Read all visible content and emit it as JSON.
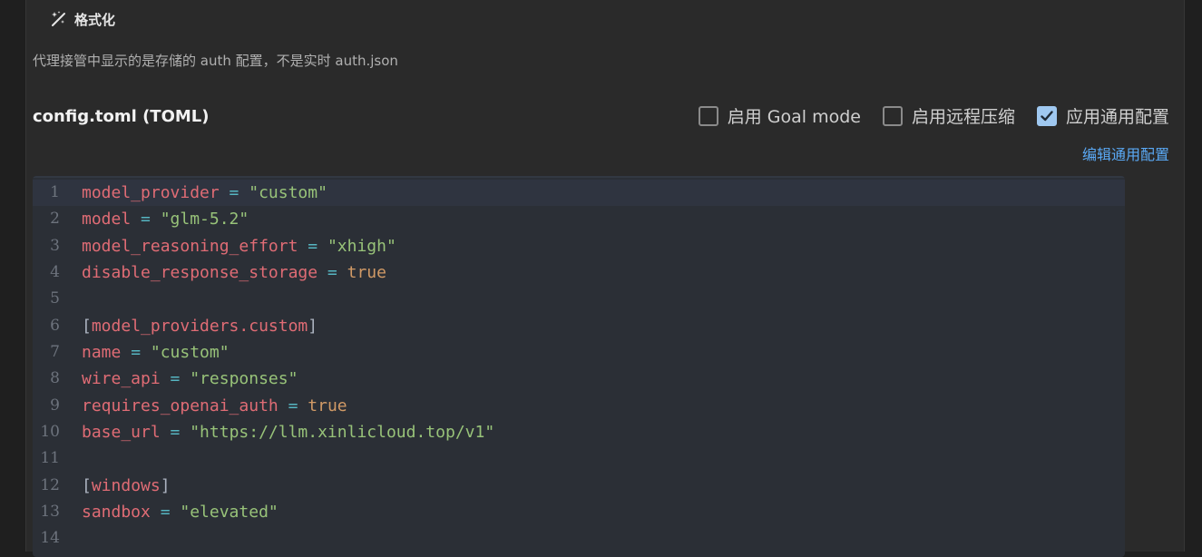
{
  "format": {
    "icon": "magic-wand-icon",
    "label": "格式化"
  },
  "hint": "代理接管中显示的是存储的 auth 配置，不是实时 auth.json",
  "config_title": "config.toml (TOML)",
  "options": [
    {
      "label": "启用 Goal mode",
      "checked": false
    },
    {
      "label": "启用远程压缩",
      "checked": false
    },
    {
      "label": "应用通用配置",
      "checked": true
    }
  ],
  "edit_link": "编辑通用配置",
  "editor": {
    "active_line": 1,
    "lines": [
      {
        "no": "1",
        "tokens": [
          {
            "t": "model_provider",
            "c": "k"
          },
          {
            "t": " = ",
            "c": "op"
          },
          {
            "t": "\"custom\"",
            "c": "s"
          }
        ]
      },
      {
        "no": "2",
        "tokens": [
          {
            "t": "model",
            "c": "k"
          },
          {
            "t": " = ",
            "c": "op"
          },
          {
            "t": "\"glm-5.2\"",
            "c": "s"
          }
        ]
      },
      {
        "no": "3",
        "tokens": [
          {
            "t": "model_reasoning_effort",
            "c": "k"
          },
          {
            "t": " = ",
            "c": "op"
          },
          {
            "t": "\"xhigh\"",
            "c": "s"
          }
        ]
      },
      {
        "no": "4",
        "tokens": [
          {
            "t": "disable_response_storage",
            "c": "k"
          },
          {
            "t": " = ",
            "c": "op"
          },
          {
            "t": "true",
            "c": "b"
          }
        ]
      },
      {
        "no": "5",
        "tokens": []
      },
      {
        "no": "6",
        "tokens": [
          {
            "t": "[",
            "c": "br"
          },
          {
            "t": "model_providers.custom",
            "c": "k"
          },
          {
            "t": "]",
            "c": "br"
          }
        ]
      },
      {
        "no": "7",
        "tokens": [
          {
            "t": "name",
            "c": "k"
          },
          {
            "t": " = ",
            "c": "op"
          },
          {
            "t": "\"custom\"",
            "c": "s"
          }
        ]
      },
      {
        "no": "8",
        "tokens": [
          {
            "t": "wire_api",
            "c": "k"
          },
          {
            "t": " = ",
            "c": "op"
          },
          {
            "t": "\"responses\"",
            "c": "s"
          }
        ]
      },
      {
        "no": "9",
        "tokens": [
          {
            "t": "requires_openai_auth",
            "c": "k"
          },
          {
            "t": " = ",
            "c": "op"
          },
          {
            "t": "true",
            "c": "b"
          }
        ]
      },
      {
        "no": "10",
        "tokens": [
          {
            "t": "base_url",
            "c": "k"
          },
          {
            "t": " = ",
            "c": "op"
          },
          {
            "t": "\"https://llm.xinlicloud.top/v1\"",
            "c": "s"
          }
        ]
      },
      {
        "no": "11",
        "tokens": []
      },
      {
        "no": "12",
        "tokens": [
          {
            "t": "[",
            "c": "br"
          },
          {
            "t": "windows",
            "c": "k"
          },
          {
            "t": "]",
            "c": "br"
          }
        ]
      },
      {
        "no": "13",
        "tokens": [
          {
            "t": "sandbox",
            "c": "k"
          },
          {
            "t": " = ",
            "c": "op"
          },
          {
            "t": "\"elevated\"",
            "c": "s"
          }
        ]
      },
      {
        "no": "14",
        "tokens": []
      }
    ]
  },
  "colors": {
    "key": "#e06c75",
    "operator": "#56b6c2",
    "string": "#98c379",
    "boolean": "#d19a66",
    "link": "#5aa9f5",
    "checkbox_checked": "#9fc8f0"
  }
}
